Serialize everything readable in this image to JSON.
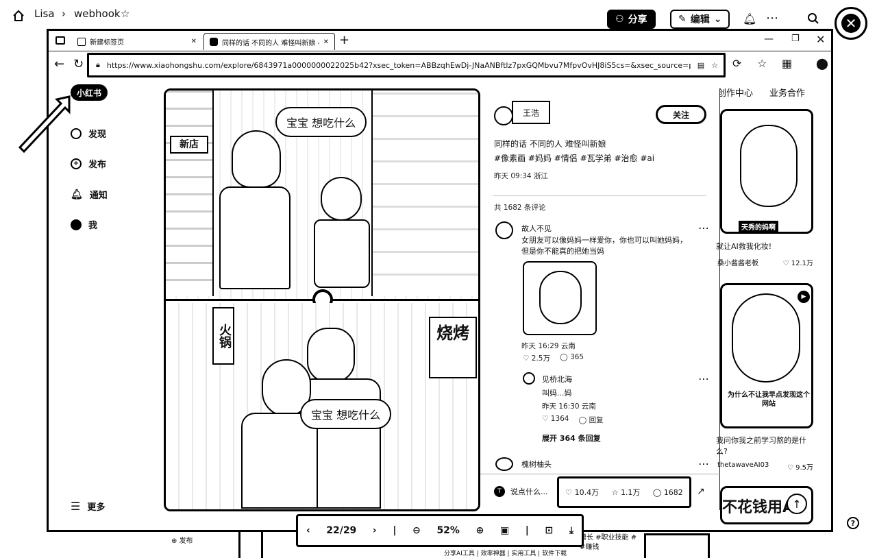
{
  "outer": {
    "breadcrumb_user": "Lisa",
    "breadcrumb_page": "webhook",
    "share_label": "分享",
    "edit_label": "编辑"
  },
  "browser": {
    "tabs": [
      {
        "label": "新建标签页"
      },
      {
        "label": "同样的话 不同的人 难怪叫新娘 -"
      }
    ],
    "url": "https://www.xiaohongshu.com/explore/6843971a0000000022025b42?xsec_token=ABBzqhEwDj-JNaANBftlz7pxGQMbvu7MfpvOvHJ8iS5cs=&xsec_source=pc_search&sou..."
  },
  "sidebar": {
    "logo": "小红书",
    "items": [
      {
        "label": "发现"
      },
      {
        "label": "发布"
      },
      {
        "label": "通知"
      },
      {
        "label": "我"
      }
    ],
    "more": "更多"
  },
  "topnav": {
    "creator": "创作中心",
    "business": "业务合作"
  },
  "image": {
    "bubble_top": "宝宝 想吃什么",
    "bubble_bottom": "宝宝 想吃什么",
    "sign_hotpot": "火锅",
    "sign_bbq": "烧烤",
    "sign_shop": "新店"
  },
  "note": {
    "author": "王浩",
    "follow": "关注",
    "title": "同样的话 不同的人 难怪叫新娘",
    "tags": "#像素画 #妈妈 #情侣 #瓦学弟 #治愈 #ai",
    "meta": "昨天 09:34 浙江",
    "comment_count": "共 1682 条评论",
    "comments": [
      {
        "user": "故人不见",
        "text": "女朋友可以像妈妈一样爱你，你也可以叫她妈妈，但是你不能真的把她当妈",
        "meta": "昨天 16:29 云南",
        "likes": "2.5万",
        "replies": "365"
      }
    ],
    "reply": {
      "user": "见桥北海",
      "text": "叫妈...妈",
      "meta": "昨天 16:30 云南",
      "likes": "1364",
      "reply_label": "回复"
    },
    "expand": "展开 364 条回复",
    "next_user": "槐树柚头",
    "input_placeholder": "说点什么...",
    "likes": "10.4万",
    "stars": "1.1万",
    "comments_total": "1682"
  },
  "feed": {
    "card1_caption": "天秀的妈啊",
    "card1_title": "就让AI救我化妆!",
    "card1_author": "桑小酱酱老板",
    "card1_likes": "12.1万",
    "card2_caption": "为什么不让我早点发现这个网站",
    "card2_title": "我问你我之前学习熬的是什么?",
    "card2_author": "thetawaveAI03",
    "card2_likes": "9.5万",
    "card3_text": "不花钱用A"
  },
  "viewer": {
    "page": "22/29",
    "zoom": "52%"
  },
  "under": {
    "publish": "发布",
    "tags": "增长 #职业技能 #",
    "tags2": "#赚钱",
    "footer": "分享AI工具 | 效率神器 | 实用工具 | 软件下载"
  }
}
